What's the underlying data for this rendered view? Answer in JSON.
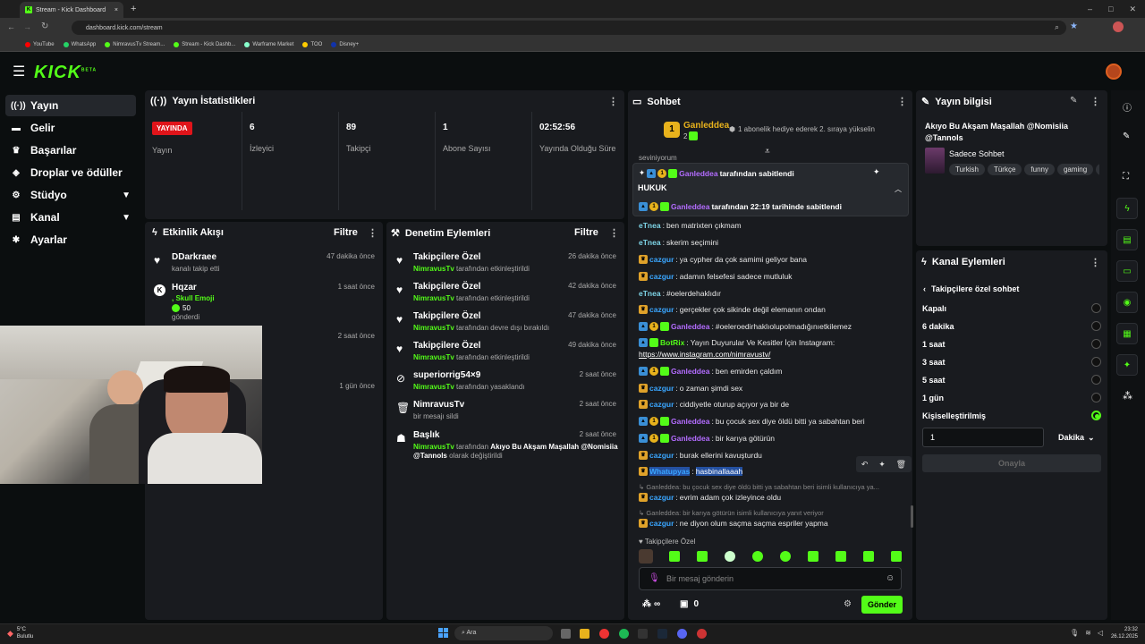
{
  "browser": {
    "tab_title": "Stream - Kick Dashboard",
    "url": "dashboard.kick.com/stream",
    "bookmarks": [
      "YouTube",
      "WhatsApp",
      "NimravusTv Stream...",
      "Stream - Kick Dashb...",
      "Warframe Market",
      "TOO",
      "Disney+"
    ]
  },
  "app": {
    "logo": "KICK",
    "logo_badge": "BETA"
  },
  "sidebar": {
    "items": [
      {
        "label": "Yayın",
        "icon": "broadcast-icon"
      },
      {
        "label": "Gelir",
        "icon": "money-icon"
      },
      {
        "label": "Başarılar",
        "icon": "trophy-icon"
      },
      {
        "label": "Droplar ve ödüller",
        "icon": "gift-icon"
      },
      {
        "label": "Stüdyo",
        "icon": "studio-icon"
      },
      {
        "label": "Kanal",
        "icon": "channel-icon"
      },
      {
        "label": "Ayarlar",
        "icon": "gear-icon"
      }
    ]
  },
  "stats": {
    "title": "Yayın İstatistikleri",
    "live_badge": "YAYINDA",
    "items": [
      {
        "value": "",
        "label": "Yayın"
      },
      {
        "value": "6",
        "label": "İzleyici"
      },
      {
        "value": "89",
        "label": "Takipçi"
      },
      {
        "value": "1",
        "label": "Abone Sayısı"
      },
      {
        "value": "02:52:56",
        "label": "Yayında Olduğu Süre"
      }
    ]
  },
  "activity": {
    "title": "Etkinlik Akışı",
    "filter": "Filtre",
    "items": [
      {
        "name": "DDarkraee",
        "sub": "kanalı takip etti",
        "time": "47 dakika önce"
      },
      {
        "name": "Hqzar",
        "sub1": ", Skull Emoji",
        "amount": "50",
        "sub2": "gönderdi",
        "time": "1 saat önce"
      },
      {
        "time": "2 saat önce"
      },
      {
        "time": "1 gün önce"
      }
    ]
  },
  "moderation": {
    "title": "Denetim Eylemleri",
    "filter": "Filtre",
    "items": [
      {
        "title": "Takipçilere Özel",
        "actor": "NimravusTv",
        "action": "tarafından etkinleştirildi",
        "time": "26 dakika önce"
      },
      {
        "title": "Takipçilere Özel",
        "actor": "NimravusTv",
        "action": "tarafından etkinleştirildi",
        "time": "42 dakika önce"
      },
      {
        "title": "Takipçilere Özel",
        "actor": "NimravusTv",
        "action": "tarafından devre dışı bırakıldı",
        "time": "47 dakika önce"
      },
      {
        "title": "Takipçilere Özel",
        "actor": "NimravusTv",
        "action": "tarafından etkinleştirildi",
        "time": "49 dakika önce"
      },
      {
        "title": "superiorrig54×9",
        "actor": "NimravusTv",
        "action": "tarafından yasaklandı",
        "time": "2 saat önce"
      },
      {
        "title": "NimravusTv",
        "actor": "",
        "action": "bir mesajı sildi",
        "time": "2 saat önce"
      },
      {
        "title": "Başlık",
        "actor": "NimravusTv",
        "action": "tarafından",
        "bold": "Akıyo Bu Akşam Maşallah @Nomisiia @Tannols",
        "action2": "olarak değiştirildi",
        "time": "2 saat önce"
      }
    ]
  },
  "chat": {
    "title": "Sohbet",
    "gifter": {
      "name": "Ganleddea",
      "count": "2",
      "rank": "1",
      "text": "1 abonelik hediye ederek 2. sıraya yükselin"
    },
    "partial_top": "seviniyorum",
    "pinned": {
      "user": "Ganleddea",
      "by": "tarafından sabitlendi",
      "message": "HUKUK",
      "footer_user": "Ganleddea",
      "footer": "tarafından 22:19 tarihinde sabitlendi"
    },
    "messages": [
      {
        "user": "eTnea",
        "text": "ben matrixten çıkmam",
        "color": "cyan",
        "badges": []
      },
      {
        "user": "eTnea",
        "text": "skerim seçimini",
        "color": "cyan",
        "badges": []
      },
      {
        "user": "cazgur",
        "text": "ya cypher da çok samimi geliyor bana",
        "color": "blue",
        "badges": [
          "crown"
        ]
      },
      {
        "user": "cazgur",
        "text": "adamın felsefesi sadece mutluluk",
        "color": "blue",
        "badges": [
          "crown"
        ]
      },
      {
        "user": "eTnea",
        "text": "#oelerdehaklıdır",
        "color": "cyan",
        "badges": []
      },
      {
        "user": "cazgur",
        "text": "gerçekler çok sikinde değil elemanın ondan",
        "color": "blue",
        "badges": [
          "crown"
        ]
      },
      {
        "user": "Ganleddea",
        "text": "#oeleroedirhaklıolupolmadığınıetkilemez",
        "color": "purple",
        "badges": [
          "blue",
          "one",
          "sub"
        ]
      },
      {
        "user": "BotRix",
        "text": "Yayın Duyurular Ve Kesitler İçin Instagram:",
        "color": "green",
        "badges": [
          "blue",
          "sub"
        ]
      },
      {
        "user": "",
        "text": "https://www.instagram.com/nimravustv/",
        "color": "link",
        "badges": []
      },
      {
        "user": "Ganleddea",
        "text": "ben emirden çaldım",
        "color": "purple",
        "badges": [
          "blue",
          "one",
          "sub"
        ]
      },
      {
        "user": "cazgur",
        "text": "o zaman şimdi sex",
        "color": "blue",
        "badges": [
          "crown"
        ]
      },
      {
        "user": "cazgur",
        "text": "ciddiyetle oturup açıyor ya bir de",
        "color": "blue",
        "badges": [
          "crown"
        ]
      },
      {
        "user": "Ganleddea",
        "text": "bu çocuk sex diye öldü bitti ya sabahtan beri",
        "color": "purple",
        "badges": [
          "blue",
          "one",
          "sub"
        ]
      },
      {
        "user": "Ganleddea",
        "text": "bir karıya götürün",
        "color": "purple",
        "badges": [
          "blue",
          "one",
          "sub"
        ]
      },
      {
        "user": "cazgur",
        "text": "burak ellerini kavuşturdu",
        "color": "blue",
        "badges": [
          "crown"
        ]
      },
      {
        "user": "Whatupyas",
        "text": "hasbinallaaah",
        "color": "blue",
        "badges": [
          "crown"
        ]
      }
    ],
    "reply1": "Ganleddea: bu çocuk sex diye öldü bitti ya sabahtan beri isimli kullanıcıya ya...",
    "msg_after1": {
      "user": "cazgur",
      "text": "evrim adam çok izleyince oldu"
    },
    "reply2": "Ganleddea: bir karıya götürün isimli kullanıcıya yanıt veriyor",
    "msg_after2": {
      "user": "cazgur",
      "text": "ne diyon olum saçma saçma espriler yapma"
    },
    "followers_only_label": "Takipçilere Özel",
    "input_placeholder": "Bir mesaj gönderin",
    "points": "∞",
    "chest_count": "0",
    "send": "Gönder"
  },
  "stream_info": {
    "title": "Yayın bilgisi",
    "stream_title": "Akıyo Bu Akşam Maşallah @Nomisiia @Tannols",
    "category": "Sadece Sohbet",
    "tags": [
      "Turkish",
      "Türkçe",
      "funny",
      "gaming",
      "t"
    ]
  },
  "channel_actions": {
    "title": "Kanal Eylemleri",
    "back_label": "Takipçilere özel sohbet",
    "options": [
      "Kapalı",
      "6 dakika",
      "1 saat",
      "3 saat",
      "5 saat",
      "1 gün",
      "Kişiselleştirilmiş"
    ],
    "selected": "Kişiselleştirilmiş",
    "custom_value": "1",
    "unit": "Dakika",
    "confirm": "Onayla"
  },
  "taskbar": {
    "weather_temp": "5°C",
    "weather_desc": "Bulutlu",
    "search": "Ara",
    "time": "23:32",
    "date": "26.12.2025"
  },
  "colors": {
    "accent": "#53fc18",
    "live": "#e0141a",
    "bg": "#0b0e0f",
    "panel": "#191b1f"
  }
}
